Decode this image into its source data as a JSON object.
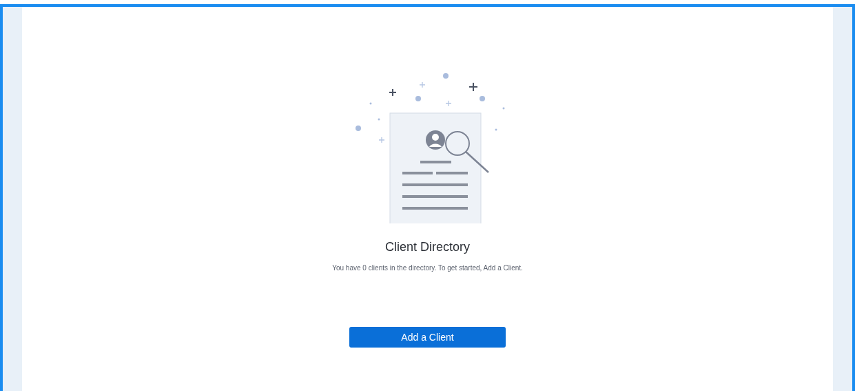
{
  "empty_state": {
    "title": "Client Directory",
    "message": "You have 0 clients in the directory. To get started, Add a Client."
  },
  "button": {
    "label": "Add a Client"
  }
}
